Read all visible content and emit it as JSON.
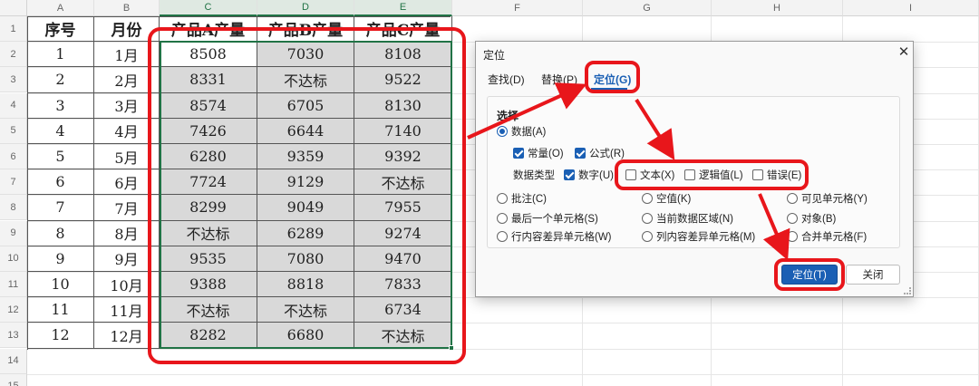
{
  "sheet": {
    "columns": [
      "A",
      "B",
      "C",
      "D",
      "E",
      "F",
      "G",
      "H",
      "I"
    ],
    "rows": [
      "1",
      "2",
      "3",
      "4",
      "5",
      "6",
      "7",
      "8",
      "9",
      "10",
      "11",
      "12",
      "13",
      "14",
      "15"
    ],
    "table_headers": [
      "序号",
      "月份",
      "产品A产量",
      "产品B产量",
      "产品C产量"
    ],
    "table_rows": [
      [
        "1",
        "1月",
        "8508",
        "7030",
        "8108"
      ],
      [
        "2",
        "2月",
        "8331",
        "不达标",
        "9522"
      ],
      [
        "3",
        "3月",
        "8574",
        "6705",
        "8130"
      ],
      [
        "4",
        "4月",
        "7426",
        "6644",
        "7140"
      ],
      [
        "5",
        "5月",
        "6280",
        "9359",
        "9392"
      ],
      [
        "6",
        "6月",
        "7724",
        "9129",
        "不达标"
      ],
      [
        "7",
        "7月",
        "8299",
        "9049",
        "7955"
      ],
      [
        "8",
        "8月",
        "不达标",
        "6289",
        "9274"
      ],
      [
        "9",
        "9月",
        "9535",
        "7080",
        "9470"
      ],
      [
        "10",
        "10月",
        "9388",
        "8818",
        "7833"
      ],
      [
        "11",
        "11月",
        "不达标",
        "不达标",
        "6734"
      ],
      [
        "12",
        "12月",
        "8282",
        "6680",
        "不达标"
      ]
    ]
  },
  "dialog": {
    "title": "定位",
    "close_glyph": "✕",
    "tabs": {
      "find": "查找(D)",
      "replace": "替换(P)",
      "goto": "定位(G)"
    },
    "section_label": "选择",
    "data_option": "数据(A)",
    "constants": "常量(O)",
    "formulas": "公式(R)",
    "data_type_label": "数据类型",
    "number": "数字(U)",
    "text": "文本(X)",
    "logical": "逻辑值(L)",
    "error": "错误(E)",
    "comments": "批注(C)",
    "blanks": "空值(K)",
    "visible_cells": "可见单元格(Y)",
    "last_cell": "最后一个单元格(S)",
    "current_region": "当前数据区域(N)",
    "objects": "对象(B)",
    "row_diff": "行内容差异单元格(W)",
    "col_diff": "列内容差异单元格(M)",
    "merged_cells": "合并单元格(F)",
    "goto_button": "定位(T)",
    "close_button": "关闭"
  },
  "colors": {
    "annotation_red": "#e8161b",
    "selection_green": "#217346",
    "accent_blue": "#1a5fb4",
    "shaded_cell": "#d9d9d9"
  },
  "icons": {
    "dialog_close": "close-icon",
    "resize_grip": "resize-grip-icon"
  }
}
